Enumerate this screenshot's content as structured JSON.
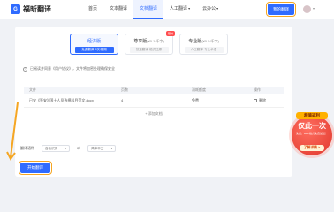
{
  "brand": {
    "logo_glyph": "G",
    "name": "福昕翻译"
  },
  "nav": {
    "items": [
      {
        "label": "首页"
      },
      {
        "label": "文本翻译"
      },
      {
        "label": "文档翻译"
      },
      {
        "label": "人工翻译"
      },
      {
        "label": "云办公"
      }
    ],
    "active_index": 2,
    "new_button": "我的翻译"
  },
  "modes": [
    {
      "name": "经济版",
      "sub": "",
      "desc": "免费翻译·2次/周期",
      "active": true,
      "badge": ""
    },
    {
      "name": "尊享版",
      "sub": "(¥0.1/千字)",
      "desc": "快速翻译·格式还原",
      "active": false,
      "badge": "限时"
    },
    {
      "name": "专业版",
      "sub": "(¥0.5/千字)",
      "desc": "人工翻译·专业术语",
      "active": false,
      "badge": ""
    }
  ],
  "notice": "已阅读并同意《用户协议》，文件将加密处理确保安全",
  "table": {
    "headers": [
      "文件",
      "页数",
      "消耗额度",
      "操作"
    ],
    "rows": [
      {
        "file": "已安《签安》·国土人员选择科目范文.docx",
        "pages": "4",
        "cost": "免费",
        "action": "删除"
      }
    ],
    "add_label": "+ 添加文档"
  },
  "language": {
    "label": "翻译语种",
    "source": "自动识别",
    "target": "简体中文"
  },
  "start_button": "开始翻译",
  "promo": {
    "top": "超值返利",
    "main": "仅此一次",
    "sub": "免费，BDF格式免费加送！",
    "button": "了解详情 >"
  },
  "colors": {
    "accent": "#2f6bff",
    "highlight": "#f5a623",
    "promo": "#e0362b"
  }
}
